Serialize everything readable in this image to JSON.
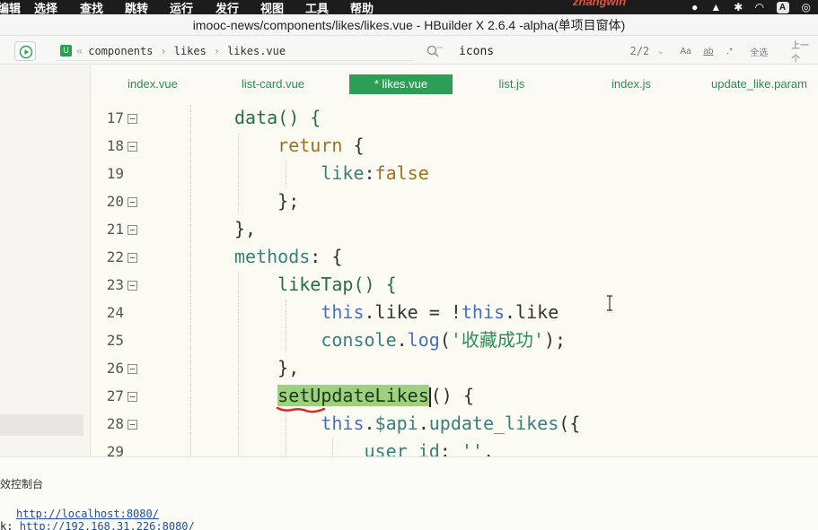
{
  "menubar": {
    "items": [
      "编辑",
      "选择",
      "查找",
      "跳转",
      "运行",
      "发行",
      "视图",
      "工具",
      "帮助"
    ],
    "overlay_name": "zhangwin",
    "tray_text_icon": "A"
  },
  "window": {
    "title": "imooc-news/components/likes/likes.vue - HBuilder X 2.6.4 -alpha(单项目窗体)"
  },
  "toolbar": {
    "breadcrumb": [
      "components",
      "likes",
      "likes.vue"
    ],
    "search_value": "icons",
    "match_count": "2/2",
    "match_case": "Aa",
    "whole_word": "ab",
    "regex": ".*",
    "select_all": "全选",
    "prev": "上一个"
  },
  "tabs": [
    {
      "label": "index.vue"
    },
    {
      "label": "list-card.vue"
    },
    {
      "label": "* likes.vue",
      "active": true
    },
    {
      "label": "list.js"
    },
    {
      "label": "index.js"
    },
    {
      "label": "update_like.param"
    }
  ],
  "editor": {
    "line_numbers": [
      "17",
      "18",
      "19",
      "20",
      "21",
      "22",
      "23",
      "24",
      "25",
      "26",
      "27",
      "28",
      "29"
    ],
    "lines": [
      {
        "segments": [
          {
            "t": "data() {",
            "c": "kw-fn"
          }
        ]
      },
      {
        "segments": [
          {
            "t": "    return",
            "c": "kw-ret"
          },
          {
            "t": " {",
            "c": ""
          }
        ]
      },
      {
        "segments": [
          {
            "t": "        like",
            "c": "kw-prop"
          },
          {
            "t": ":",
            "c": ""
          },
          {
            "t": "false",
            "c": "kw-false"
          }
        ]
      },
      {
        "segments": [
          {
            "t": "    };",
            "c": ""
          }
        ]
      },
      {
        "segments": [
          {
            "t": "},",
            "c": ""
          }
        ]
      },
      {
        "segments": [
          {
            "t": "methods",
            "c": "kw-prop"
          },
          {
            "t": ": {",
            "c": ""
          }
        ]
      },
      {
        "segments": [
          {
            "t": "    likeTap() {",
            "c": "kw-fn"
          }
        ]
      },
      {
        "segments": [
          {
            "t": "        this",
            "c": "kw-this"
          },
          {
            "t": ".like = !",
            "c": ""
          },
          {
            "t": "this",
            "c": "kw-this"
          },
          {
            "t": ".like",
            "c": ""
          }
        ]
      },
      {
        "segments": [
          {
            "t": "        console",
            "c": "kw-prop"
          },
          {
            "t": ".",
            "c": ""
          },
          {
            "t": "log",
            "c": "kw-this"
          },
          {
            "t": "(",
            "c": ""
          },
          {
            "t": "'收藏成功'",
            "c": "kw-str"
          },
          {
            "t": ");",
            "c": ""
          }
        ]
      },
      {
        "segments": [
          {
            "t": "    },",
            "c": ""
          }
        ]
      },
      {
        "segments": [
          {
            "t": "    ",
            "c": ""
          },
          {
            "t": "setUpdateLikes",
            "c": "hl-word"
          },
          {
            "t": "CARET",
            "c": "caret"
          },
          {
            "t": "() {",
            "c": ""
          }
        ]
      },
      {
        "segments": [
          {
            "t": "        this",
            "c": "kw-this"
          },
          {
            "t": ".",
            "c": ""
          },
          {
            "t": "$api",
            "c": "kw-prop"
          },
          {
            "t": ".",
            "c": ""
          },
          {
            "t": "update_likes",
            "c": "kw-prop"
          },
          {
            "t": "({",
            "c": ""
          }
        ]
      },
      {
        "segments": [
          {
            "t": "            user_id",
            "c": "kw-prop"
          },
          {
            "t": ": ",
            "c": ""
          },
          {
            "t": "''",
            "c": "kw-str"
          },
          {
            "t": ",",
            "c": ""
          }
        ]
      }
    ]
  },
  "console": {
    "title": "效控制台",
    "line1_url": "http://localhost:8080/",
    "line2_prefix": "k: ",
    "line2_url": "http://192.168.31.226:8080/"
  },
  "colors": {
    "accent": "#2d9e55",
    "highlight": "#9ed07f"
  }
}
